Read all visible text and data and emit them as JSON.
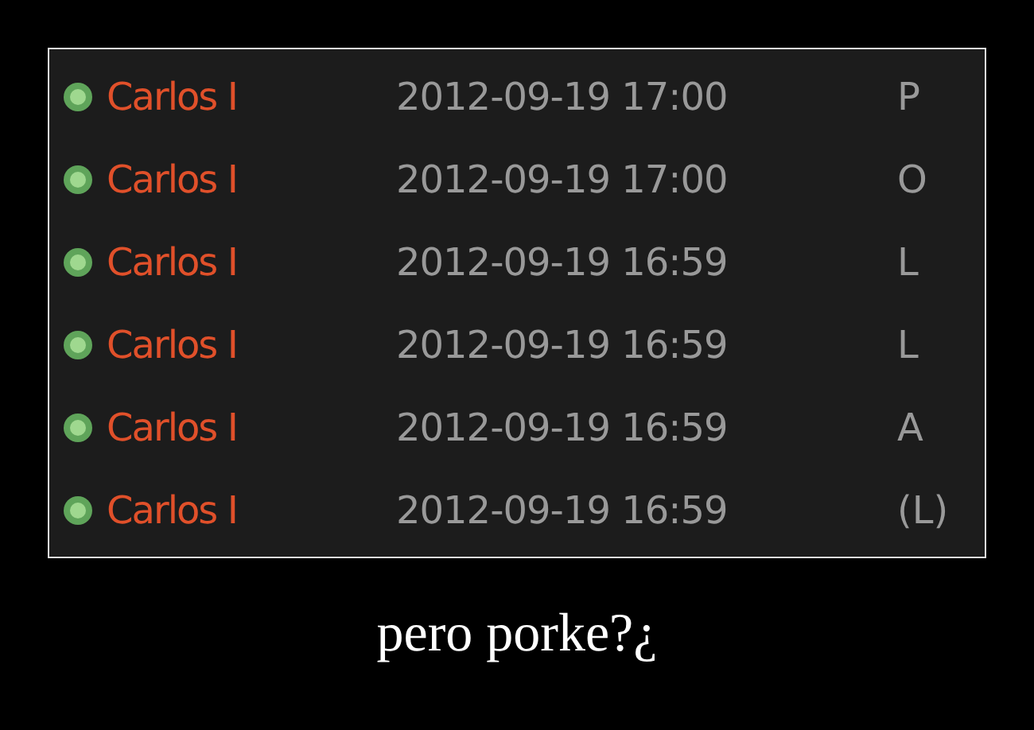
{
  "messages": [
    {
      "sender": "Carlos I",
      "time": "2012-09-19 17:00",
      "text": "P"
    },
    {
      "sender": "Carlos I",
      "time": "2012-09-19 17:00",
      "text": "O"
    },
    {
      "sender": "Carlos I",
      "time": "2012-09-19 16:59",
      "text": "L"
    },
    {
      "sender": "Carlos I",
      "time": "2012-09-19 16:59",
      "text": "L"
    },
    {
      "sender": "Carlos I",
      "time": "2012-09-19 16:59",
      "text": "A"
    },
    {
      "sender": "Carlos I",
      "time": "2012-09-19 16:59",
      "text": "(L)"
    }
  ],
  "caption": "pero porke?¿"
}
